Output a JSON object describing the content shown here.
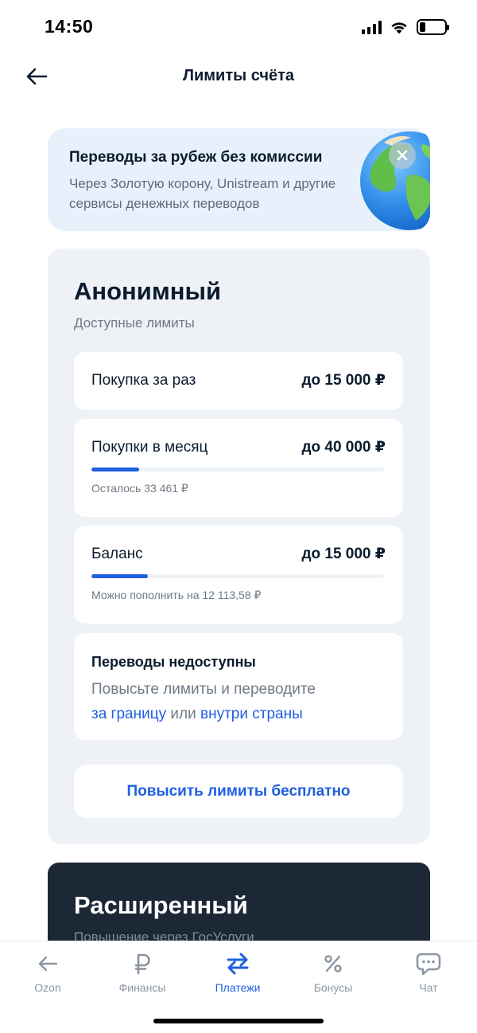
{
  "status_bar": {
    "time": "14:50",
    "battery_level": 0.22
  },
  "header": {
    "title": "Лимиты счёта"
  },
  "promo": {
    "title": "Переводы за рубеж без комиссии",
    "text": "Через Золотую корону, Unistream и другие сервисы денежных переводов"
  },
  "tier_basic": {
    "title": "Анонимный",
    "subtitle": "Доступные лимиты",
    "limits": [
      {
        "label": "Покупка за раз",
        "value": "до 15 000 ₽"
      },
      {
        "label": "Покупки в месяц",
        "value": "до 40 000 ₽",
        "progress": 0.163,
        "note": "Осталось 33 461 ₽"
      },
      {
        "label": "Баланс",
        "value": "до 15 000 ₽",
        "progress": 0.193,
        "note": "Можно пополнить на 12 113,58 ₽"
      }
    ],
    "transfers": {
      "title": "Переводы недоступны",
      "text": "Повысьте лимиты и переводите",
      "link_abroad": "за границу",
      "conjunction": "или",
      "link_domestic": "внутри страны"
    },
    "raise_button": "Повысить лимиты бесплатно"
  },
  "tier_extended": {
    "title": "Расширенный",
    "subtitle": "Повышение через ГосУслуги"
  },
  "tabs": [
    {
      "label": "Ozon",
      "icon": "arrow-left-icon"
    },
    {
      "label": "Финансы",
      "icon": "ruble-icon"
    },
    {
      "label": "Платежи",
      "icon": "transfer-arrows-icon",
      "active": true
    },
    {
      "label": "Бонусы",
      "icon": "percent-icon"
    },
    {
      "label": "Чат",
      "icon": "chat-bubble-icon"
    }
  ],
  "colors": {
    "accent": "#1f5fe0",
    "dark_card": "#1d2836",
    "promo_bg": "#e8f1fb",
    "card_bg": "#eef1f5"
  }
}
